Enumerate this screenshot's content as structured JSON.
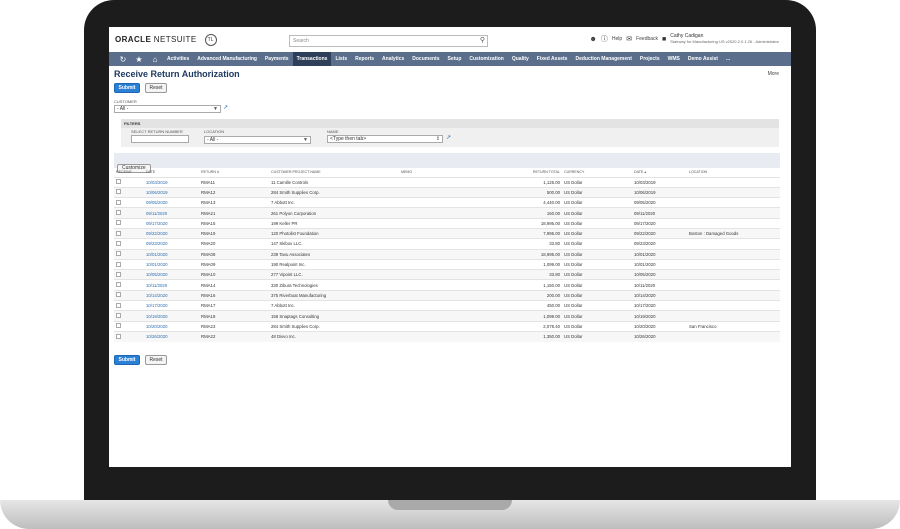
{
  "app": {
    "logo_main": "ORACLE",
    "logo_suffix": " NETSUITE",
    "badge": "TL"
  },
  "search": {
    "placeholder": "Search"
  },
  "topright": {
    "help": "Help",
    "feedback": "Feedback",
    "user_name": "Cathy Cadigan",
    "user_role": "Stairway for Manufacturing US v2020.2.0.1.26 - Administrator"
  },
  "nav": {
    "items": [
      "Activities",
      "Advanced Manufacturing",
      "Payments",
      "Transactions",
      "Lists",
      "Reports",
      "Analytics",
      "Documents",
      "Setup",
      "Customization",
      "Quality",
      "Fixed Assets",
      "Deduction Management",
      "Projects",
      "WMS",
      "Demo Assist",
      "..."
    ],
    "active": 3
  },
  "page": {
    "title": "Receive Return Authorization",
    "more": "More",
    "submit": "Submit",
    "reset": "Reset"
  },
  "customer": {
    "label": "CUSTOMER",
    "value": "- All -"
  },
  "filters": {
    "header": "FILTERS",
    "return_label": "SELECT RETURN NUMBER",
    "location_label": "LOCATION",
    "location_value": "- All -",
    "name_label": "NAME",
    "name_value": "<Type then tab>"
  },
  "list": {
    "customize": "Customize",
    "columns": [
      "Receive",
      "Date",
      "Return #",
      "Customer:Project Name",
      "Memo",
      "Return Total",
      "Currency",
      "Date ▴",
      "Location"
    ],
    "rows": [
      [
        "10/03/2019",
        "RMA11",
        "11 Camille Controls",
        "",
        "1,125.00",
        "US Dollar",
        "10/03/2019",
        ""
      ],
      [
        "10/06/2019",
        "RMA12",
        "284 Smith Supplies Corp.",
        "",
        "500.00",
        "US Dollar",
        "10/06/2019",
        ""
      ],
      [
        "09/05/2020",
        "RMA13",
        "7 Abbott Inc.",
        "",
        "4,440.00",
        "US Dollar",
        "09/05/2020",
        ""
      ],
      [
        "09/11/2020",
        "RMA21",
        "261 Polyon Corporation",
        "",
        "160.00",
        "US Dollar",
        "09/11/2020",
        ""
      ],
      [
        "09/17/2020",
        "RMA15",
        "199 Keller PR",
        "",
        "18,995.00",
        "US Dollar",
        "09/17/2020",
        ""
      ],
      [
        "09/22/2020",
        "RMA19",
        "120 Photolist Foundation",
        "",
        "7,995.00",
        "US Dollar",
        "09/22/2020",
        "Boston : Damaged Goods"
      ],
      [
        "09/23/2020",
        "RMA20",
        "147 Skibox LLC.",
        "",
        "33.80",
        "US Dollar",
        "09/23/2020",
        ""
      ],
      [
        "10/01/2020",
        "RMA08",
        "239 Tavu Associates",
        "",
        "18,995.00",
        "US Dollar",
        "10/01/2020",
        ""
      ],
      [
        "10/01/2020",
        "RMA09",
        "190 Realpoint Inc.",
        "",
        "1,099.00",
        "US Dollar",
        "10/01/2020",
        ""
      ],
      [
        "10/05/2020",
        "RMA10",
        "277 Vipoint LLC.",
        "",
        "33.80",
        "US Dollar",
        "10/05/2020",
        ""
      ],
      [
        "10/11/2020",
        "RMA14",
        "330 Zibura Technologies",
        "",
        "1,150.00",
        "US Dollar",
        "10/11/2020",
        ""
      ],
      [
        "10/14/2020",
        "RMA16",
        "375 Riverboat Manufacturing",
        "",
        "200.00",
        "US Dollar",
        "10/14/2020",
        ""
      ],
      [
        "10/17/2020",
        "RMA17",
        "7 Abbott Inc.",
        "",
        "450.00",
        "US Dollar",
        "10/17/2020",
        ""
      ],
      [
        "10/19/2020",
        "RMA18",
        "158 Snaptags Consulting",
        "",
        "1,099.00",
        "US Dollar",
        "10/19/2020",
        ""
      ],
      [
        "10/20/2020",
        "RMA23",
        "284 Smith Supplies Corp.",
        "",
        "2,078.40",
        "US Dollar",
        "10/20/2020",
        "San Francisco"
      ],
      [
        "10/26/2020",
        "RMA22",
        "48 Divvo Inc.",
        "",
        "1,350.00",
        "US Dollar",
        "10/26/2020",
        ""
      ]
    ]
  }
}
